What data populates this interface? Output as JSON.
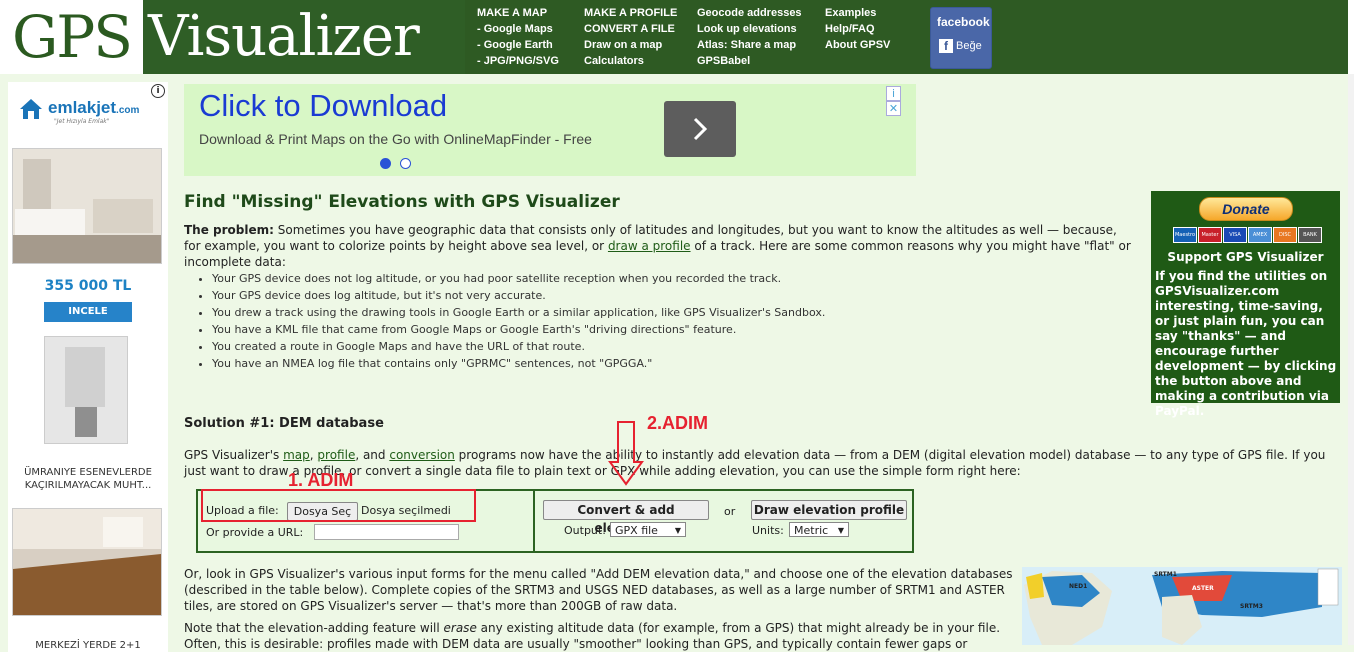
{
  "logo": {
    "part1": "GPS",
    "part2": "Visualizer"
  },
  "nav": {
    "col1": [
      "MAKE A MAP",
      "- Google Maps",
      "- Google Earth",
      "- JPG/PNG/SVG"
    ],
    "col2": [
      "MAKE A PROFILE",
      "CONVERT A FILE",
      "Draw on a map",
      "Calculators"
    ],
    "col3": [
      "Geocode addresses",
      "Look up elevations",
      "Atlas: Share a map",
      "GPSBabel"
    ],
    "col4": [
      "Examples",
      "Help/FAQ",
      "About GPSV"
    ]
  },
  "facebook": {
    "title": "facebook",
    "like": "Beğe"
  },
  "left_ad": {
    "brand": "emlakjet",
    "brand_suffix": ".com",
    "tagline": "\"Jet Hızıyla Emlak\"",
    "info": "i",
    "price": "355 000 TL",
    "button": "INCELE",
    "caption2": "ÜMRANIYE ESENEVLERDE KAÇIRILMAYACAK MUHT...",
    "caption3": "MERKEZİ YERDE 2+1"
  },
  "top_ad": {
    "headline": "Click to Download",
    "subline": "Download & Print Maps on the Go with OnlineMapFinder - Free",
    "info": "i",
    "close": "✕"
  },
  "page": {
    "title": "Find \"Missing\" Elevations with GPS Visualizer",
    "problem_label": "The problem:",
    "problem_text_1": " Sometimes you have geographic data that consists only of latitudes and longitudes, but you want to know the altitudes as well — because, for example, you want to colorize points by height above sea level, or ",
    "problem_link": "draw a profile",
    "problem_text_2": " of a track. Here are some common reasons why you might have \"flat\" or incomplete data:",
    "reasons": [
      "Your GPS device does not log altitude, or you had poor satellite reception when you recorded the track.",
      "Your GPS device does log altitude, but it's not very accurate.",
      "You drew a track using the drawing tools in Google Earth or a similar application, like GPS Visualizer's Sandbox.",
      "You have a KML file that came from Google Maps or Google Earth's \"driving directions\" feature.",
      "You created a route in Google Maps and have the URL of that route.",
      "You have an NMEA log file that contains only \"GPRMC\" sentences, not \"GPGGA.\""
    ],
    "solution_title": "Solution #1: DEM database",
    "solution_text_1": "GPS Visualizer's ",
    "link_map": "map",
    "link_profile": "profile",
    "link_conversion": "conversion",
    "solution_text_2": " programs now have the ability to instantly add elevation data — from a DEM (digital elevation model) database — to any type of GPS file. If you just want to draw a profile, or convert a single data file to plain text or GPX while adding elevation, you can use the simple form right here:",
    "more_text": "Or, look in GPS Visualizer's various input forms for the menu called \"Add DEM elevation data,\" and choose one of the elevation databases (described in the table below). Complete copies of the SRTM3 and USGS NED databases, as well as a large number of SRTM1 and ASTER tiles, are stored on GPS Visualizer's server — that's more than 200GB of raw data.",
    "note_text_1": "Note that the elevation-adding feature will ",
    "note_em": "erase",
    "note_text_2": " any existing altitude data (for example, from a GPS) that might already be in your file. Often, this is desirable: profiles made with DEM data are usually \"smoother\" looking than GPS, and typically contain fewer gaps or"
  },
  "form": {
    "upload_label": "Upload a file:",
    "choose_button": "Dosya Seç",
    "no_file": "Dosya seçilmedi",
    "url_label": "Or provide a URL:",
    "url_value": "",
    "convert_button": "Convert & add elevation",
    "output_label": "Output:",
    "output_value": "GPX file",
    "or": "or",
    "profile_button": "Draw elevation profile",
    "units_label": "Units:",
    "units_value": "Metric"
  },
  "annotations": {
    "step1": "1. ADIM",
    "step2": "2.ADIM"
  },
  "support": {
    "donate": "Donate",
    "cards": [
      "Maestro",
      "Master",
      "VISA",
      "AMEX",
      "DISC",
      "BANK"
    ],
    "title": "Support GPS Visualizer",
    "body": "If you find the utilities on GPSVisualizer.com interesting, time-saving, or just plain fun, you can say \"thanks\" — and encourage further development — by clicking the button above and making a contribution via PayPal."
  },
  "map": {
    "labels": [
      "NED1",
      "SRTM1",
      "ASTER",
      "SRTM3"
    ]
  },
  "colors": {
    "header": "#2e5a23",
    "accent_red": "#e62230",
    "link": "#1f5c17",
    "support_bg": "#1f5a15"
  }
}
